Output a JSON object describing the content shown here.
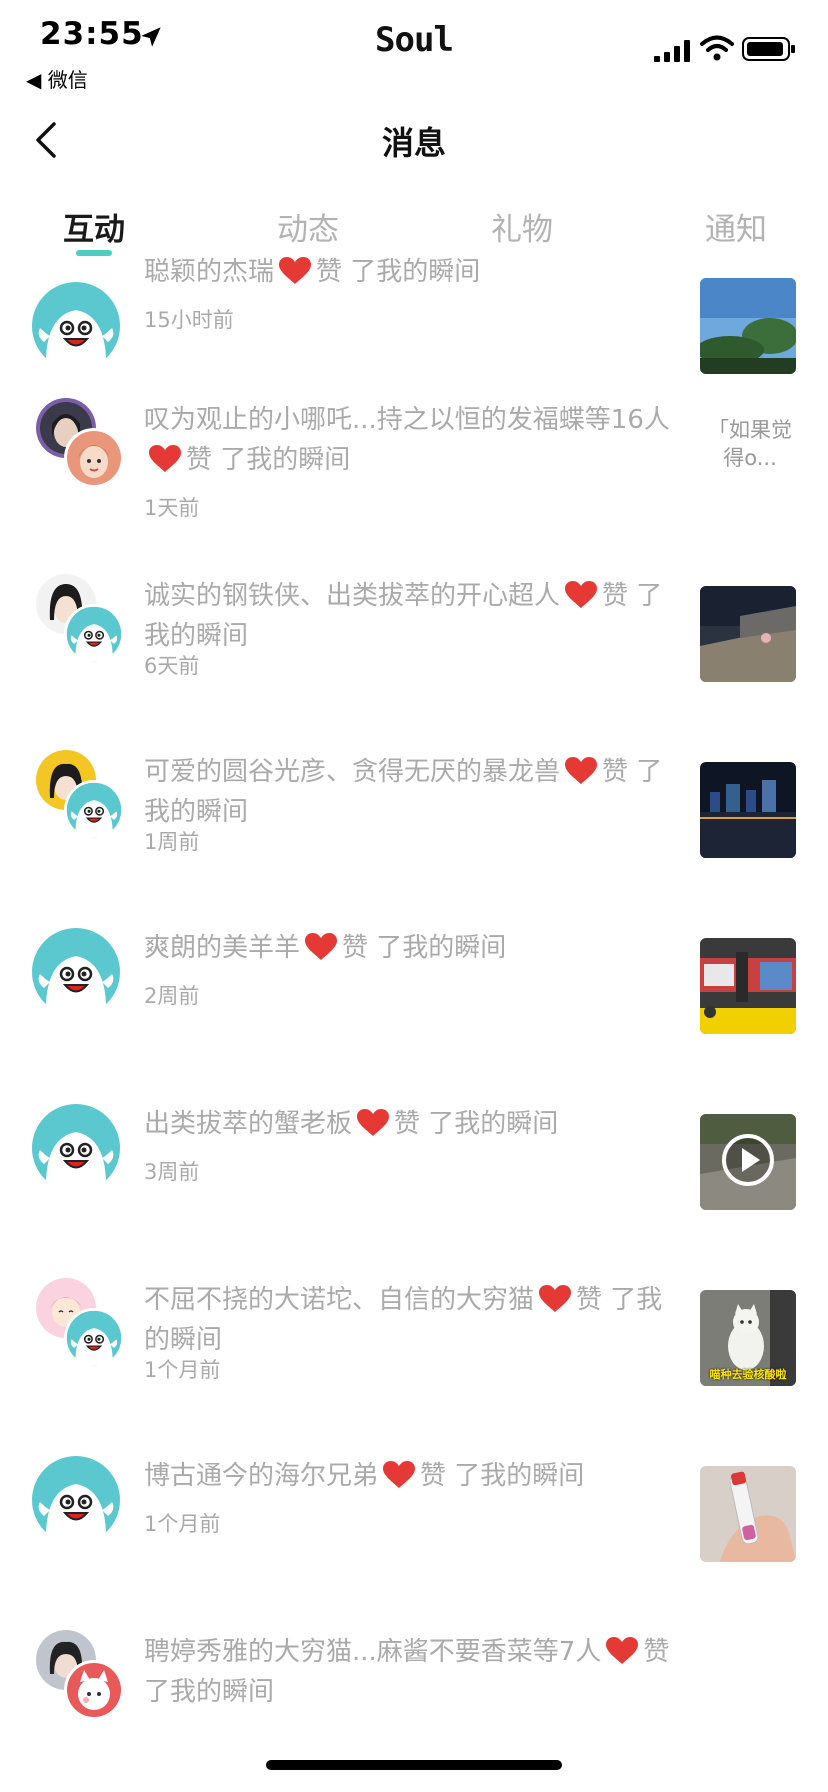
{
  "status": {
    "time": "23:55",
    "back_app": "◀ 微信",
    "brand": "Soul"
  },
  "nav": {
    "title": "消息"
  },
  "tabs": [
    {
      "label": "互动",
      "active": true
    },
    {
      "label": "动态",
      "active": false
    },
    {
      "label": "礼物",
      "active": false
    },
    {
      "label": "通知",
      "active": false
    }
  ],
  "items": [
    {
      "names": "聪颖的杰瑞",
      "action": "赞",
      "suffix": "了我的瞬间",
      "time": "15小时前",
      "thumb": "photo-trees"
    },
    {
      "names": "叹为观止的小哪吒...持之以恒的发福蝶等16人",
      "action": "赞",
      "suffix": "了我的瞬间",
      "time": "1天前",
      "thumb_text": "「如果觉得o..."
    },
    {
      "names": "诚实的钢铁侠、出类拔萃的开心超人",
      "action": "赞",
      "suffix": "了我的瞬间",
      "time": "6天前",
      "thumb": "photo-night-river"
    },
    {
      "names": "可爱的圆谷光彦、贪得无厌的暴龙兽",
      "action": "赞",
      "suffix": "了我的瞬间",
      "time": "1周前",
      "thumb": "photo-city-night"
    },
    {
      "names": "爽朗的美羊羊",
      "action": "赞",
      "suffix": "了我的瞬间",
      "time": "2周前",
      "thumb": "photo-station"
    },
    {
      "names": "出类拔萃的蟹老板",
      "action": "赞",
      "suffix": "了我的瞬间",
      "time": "3周前",
      "thumb": "video-street"
    },
    {
      "names": "不屈不挠的大诺坨、自信的大穷猫",
      "action": "赞",
      "suffix": "了我的瞬间",
      "time": "1个月前",
      "thumb": "photo-cat",
      "thumb_caption": "喵种去验核酸啦"
    },
    {
      "names": "博古通今的海尔兄弟",
      "action": "赞",
      "suffix": "了我的瞬间",
      "time": "1个月前",
      "thumb": "photo-tube"
    },
    {
      "names": "聘婷秀雅的大穷猫...麻酱不要香菜等7人",
      "action": "赞",
      "suffix": "了我的瞬间",
      "time": "",
      "thumb": ""
    }
  ]
}
